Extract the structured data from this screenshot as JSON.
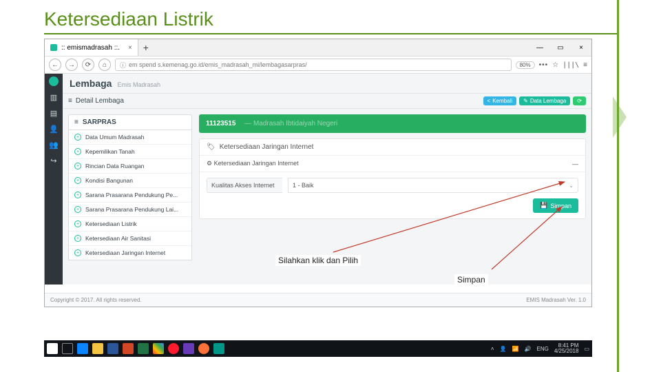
{
  "slide": {
    "title": "Ketersediaan Listrik"
  },
  "browser": {
    "tab_title": ":: emismadrasah ::.",
    "url": "em spend s.kemenag.go.id/emis_madrasah_mi/lembagasarpras/",
    "zoom": "80%"
  },
  "app": {
    "breadcrumb_main": "Lembaga",
    "breadcrumb_sub": "Emis Madrasah",
    "subbar_title": "Detail Lembaga",
    "btn_back": "Kembali",
    "btn_data": "Data Lembaga",
    "sidebar_title": "SARPRAS",
    "sidebar_items": [
      "Data Umum Madrasah",
      "Kepemilikan Tanah",
      "Rincian Data Ruangan",
      "Kondisi Bangunan",
      "Sarana Prasarana Pendukung Pe...",
      "Sarana Prasarana Pendukung Lai...",
      "Ketersediaan Listrik",
      "Ketersediaan Air Sanitasi",
      "Ketersediaan Jaringan Internet"
    ],
    "banner_id": "11123515",
    "banner_rest": " — Madrasah Ibtidaiyah Negeri",
    "card_title": "Ketersediaan Jaringan Internet",
    "card_sub": "Ketersediaan Jaringan Internet",
    "field_label": "Kualitas Akses Internet",
    "field_value": "1 - Baik",
    "btn_save": "Simpan",
    "footer_left": "Copyright © 2017. All rights reserved.",
    "footer_right": "EMIS Madrasah Ver. 1.0"
  },
  "taskbar": {
    "lang": "ENG",
    "time": "8:41 PM",
    "date": "4/25/2018"
  },
  "callouts": {
    "c1": "Silahkan klik dan Pilih",
    "c2": "Simpan"
  }
}
